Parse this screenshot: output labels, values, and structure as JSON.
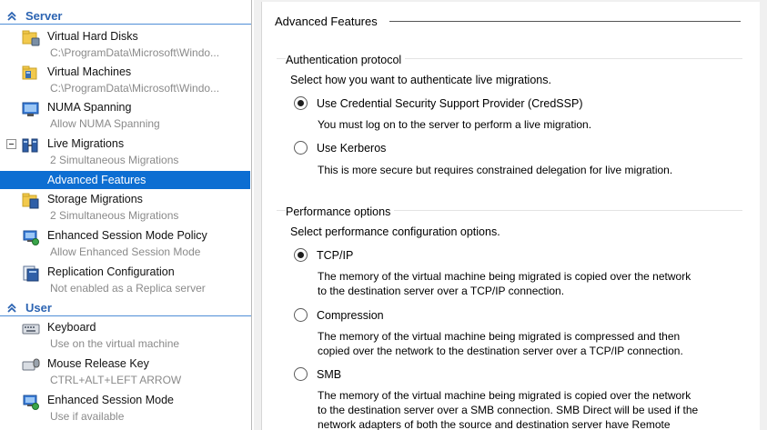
{
  "nav": {
    "server_header": "Server",
    "server_items": [
      {
        "label": "Virtual Hard Disks",
        "sub": "C:\\ProgramData\\Microsoft\\Windo...",
        "icon": "disk-folder-icon"
      },
      {
        "label": "Virtual Machines",
        "sub": "C:\\ProgramData\\Microsoft\\Windo...",
        "icon": "vm-folder-icon"
      },
      {
        "label": "NUMA Spanning",
        "sub": "Allow NUMA Spanning",
        "icon": "numa-icon"
      },
      {
        "label": "Live Migrations",
        "sub": "2 Simultaneous Migrations",
        "icon": "live-migration-icon"
      },
      {
        "label": "Advanced Features",
        "selected": true
      },
      {
        "label": "Storage Migrations",
        "sub": "2 Simultaneous Migrations",
        "icon": "storage-migration-icon"
      },
      {
        "label": "Enhanced Session Mode Policy",
        "sub": "Allow Enhanced Session Mode",
        "icon": "session-policy-icon"
      },
      {
        "label": "Replication Configuration",
        "sub": "Not enabled as a Replica server",
        "icon": "replication-icon"
      }
    ],
    "user_header": "User",
    "user_items": [
      {
        "label": "Keyboard",
        "sub": "Use on the virtual machine",
        "icon": "keyboard-icon"
      },
      {
        "label": "Mouse Release Key",
        "sub": "CTRL+ALT+LEFT ARROW",
        "icon": "mouse-icon"
      },
      {
        "label": "Enhanced Session Mode",
        "sub": "Use if available",
        "icon": "session-mode-icon"
      }
    ]
  },
  "panel": {
    "heading": "Advanced Features",
    "auth": {
      "title": "Authentication protocol",
      "description": "Select how you want to authenticate live migrations.",
      "options": [
        {
          "label": "Use Credential Security Support Provider (CredSSP)",
          "help": "You must log on to the server to perform a live migration.",
          "selected": true
        },
        {
          "label": "Use Kerberos",
          "help": "This is more secure but requires constrained delegation for live migration.",
          "selected": false
        }
      ]
    },
    "perf": {
      "title": "Performance options",
      "description": "Select performance configuration options.",
      "options": [
        {
          "label": "TCP/IP",
          "help1": "The memory of the virtual machine being migrated is copied over the network",
          "help2": "to the destination server over a TCP/IP connection.",
          "selected": true
        },
        {
          "label": "Compression",
          "help1": "The memory of the virtual machine being migrated is compressed and then",
          "help2": "copied over the network to the destination server over a TCP/IP connection.",
          "selected": false
        },
        {
          "label": "SMB",
          "help1": "The memory of the virtual machine being migrated is copied over the network",
          "help2": "to the destination server over a SMB connection. SMB Direct will be used if the",
          "help3": "network adapters of both the source and destination server have Remote",
          "selected": false
        }
      ]
    }
  },
  "colors": {
    "accent": "#0d6ed2",
    "header_text": "#2c64b2",
    "muted": "#8a8a8a"
  }
}
